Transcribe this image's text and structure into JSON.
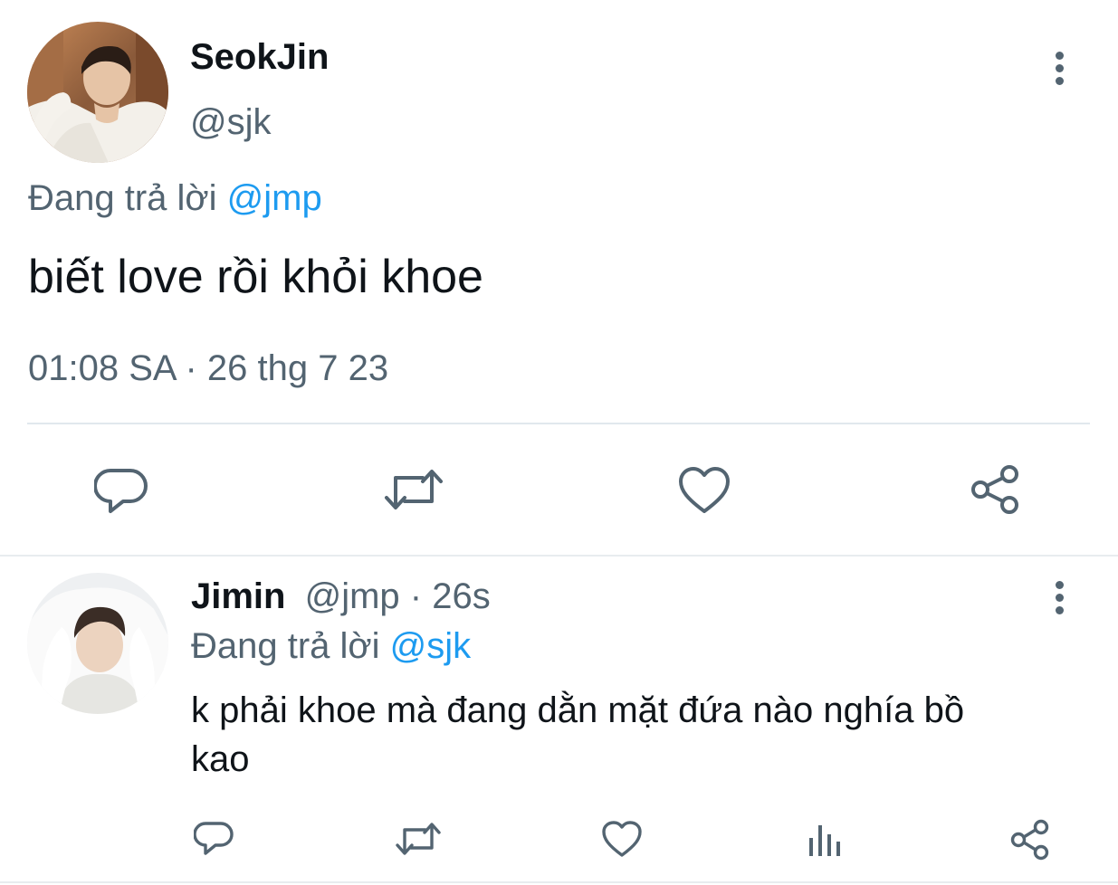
{
  "main_tweet": {
    "display_name": "SeokJin",
    "handle": "@sjk",
    "replying_prefix": "Đang trả lời",
    "replying_to": "@jmp",
    "text": "biết love rồi khỏi khoe",
    "timestamp": "01:08 SA · 26 thg 7 23",
    "avatar": "avatar-seokjin"
  },
  "reply_tweet": {
    "display_name": "Jimin",
    "handle": "@jmp",
    "separator": "·",
    "time": "26s",
    "replying_prefix": "Đang trả lời",
    "replying_to": "@sjk",
    "text_line1": "k phải khoe mà đang dằn mặt đứa nào nghía bồ",
    "text_line2": "kao",
    "avatar": "avatar-jimin"
  },
  "icons": {
    "more": "more-vertical-icon",
    "reply": "reply-icon",
    "retweet": "retweet-icon",
    "like": "heart-icon",
    "share": "share-icon",
    "analytics": "analytics-icon"
  },
  "colors": {
    "text": "#0f1419",
    "muted": "#536471",
    "link": "#1d9bf0",
    "divider": "#e1e8ed"
  }
}
